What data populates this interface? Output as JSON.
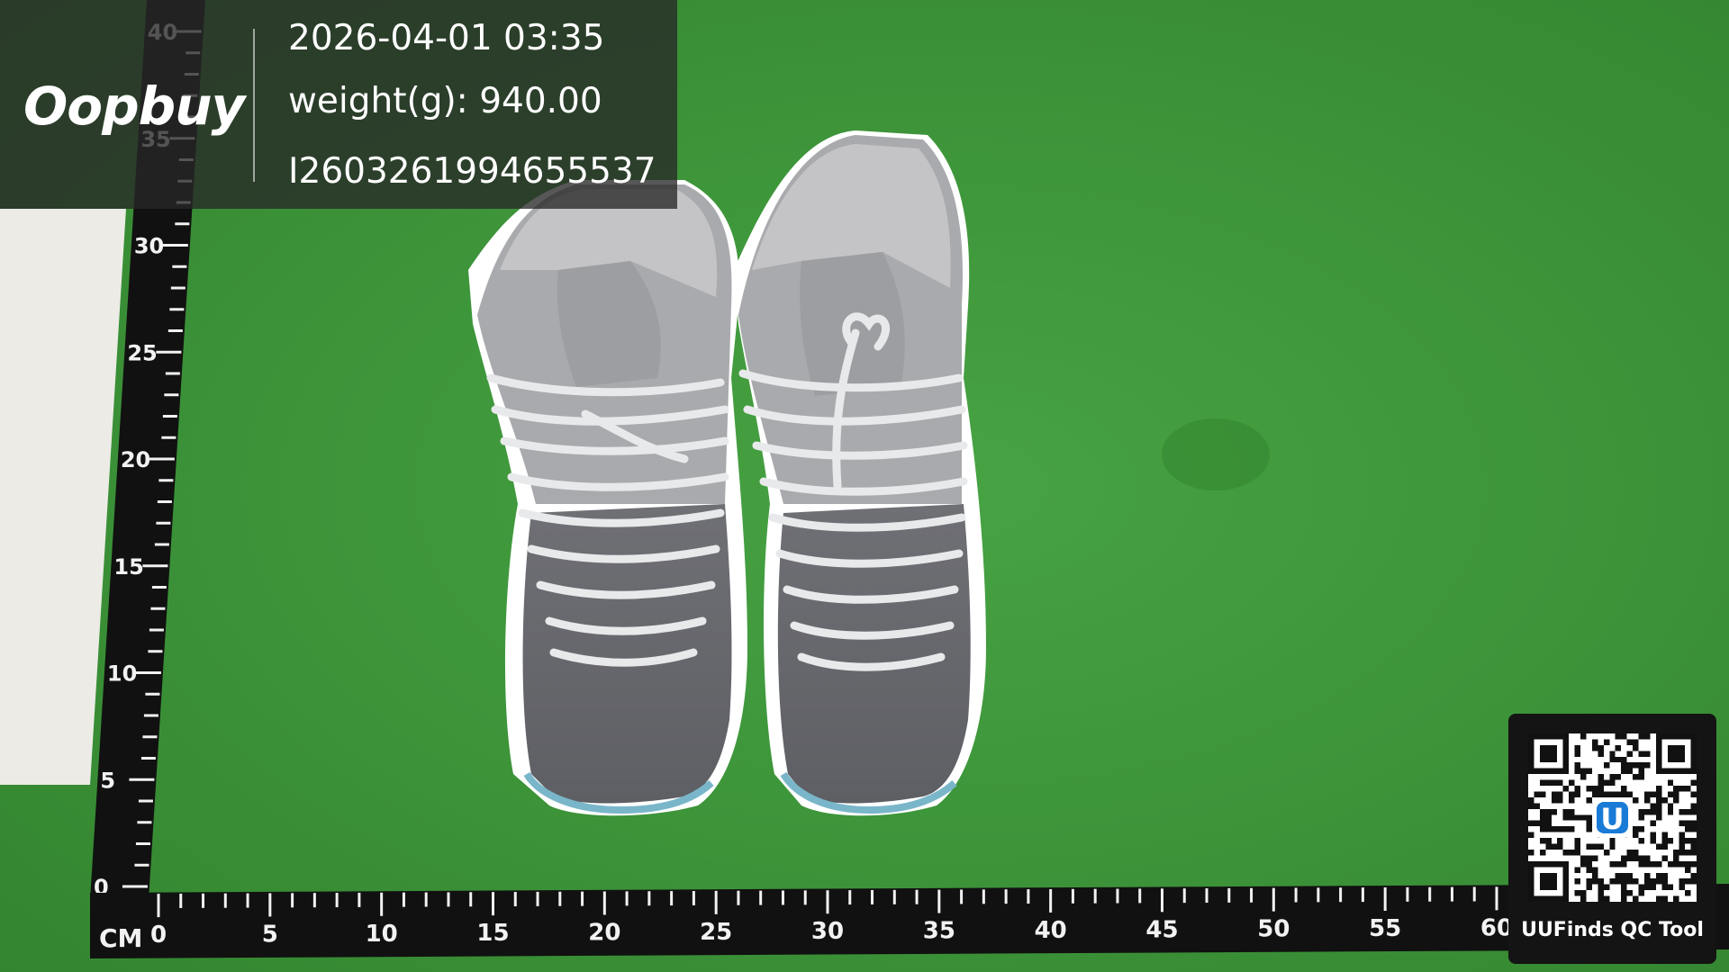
{
  "overlay": {
    "timestamp": "2026-04-01 03:35",
    "weight": "weight(g): 940.00",
    "order_id": "I2603261994655537"
  },
  "brand": {
    "logo_text": "Oopbuy"
  },
  "qr_card": {
    "label": "UUFinds QC Tool",
    "center_badge_text": "U"
  },
  "ruler": {
    "unit_label": "CM",
    "vertical_ticks": [
      "40",
      "35",
      "30",
      "25",
      "20",
      "15",
      "10",
      "5",
      "0"
    ],
    "horizontal_ticks": [
      "0",
      "5",
      "10",
      "15",
      "20",
      "25",
      "30",
      "35",
      "40",
      "45",
      "50",
      "55",
      "60"
    ]
  },
  "colors": {
    "mat_green": "#3f9a3c",
    "ruler_black": "#111111",
    "shoe_grey": "#7a7b80",
    "shoe_light_grey": "#b9b9bb",
    "icy_sole": "#7ab6c9"
  }
}
